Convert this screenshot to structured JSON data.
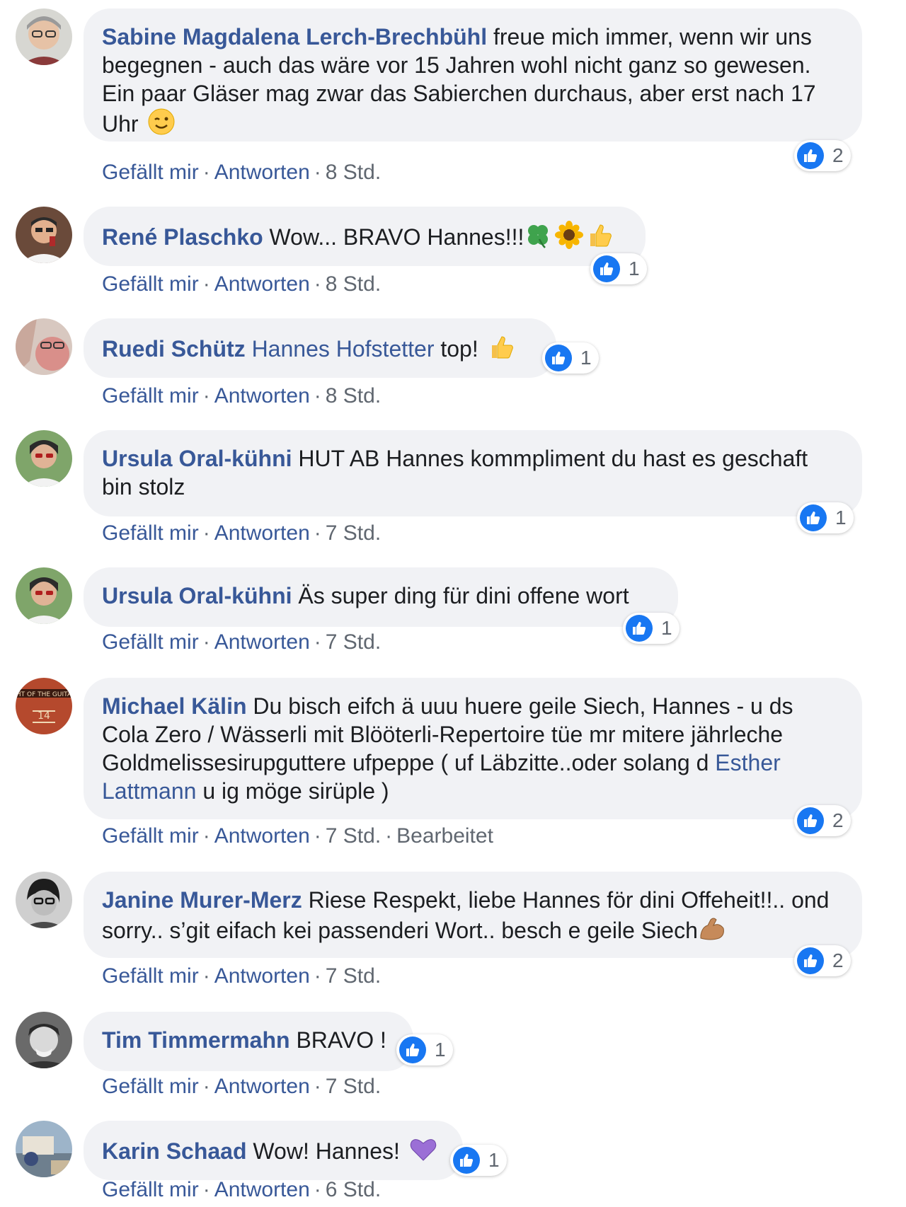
{
  "ui": {
    "like_label": "Gefällt mir",
    "reply_label": "Antworten",
    "dot": "·"
  },
  "colors": {
    "author": "#385898",
    "bubble_bg": "#f1f2f5",
    "like_blue": "#1877f2",
    "meta": "#606770"
  },
  "comments": [
    {
      "author": "Sabine Magdalena Lerch-Brechbühl",
      "text": "freue mich immer, wenn wir uns begegnen - auch das wäre vor 15 Jahren wohl nicht ganz so gewesen. Ein paar Gläser mag zwar das Sabierchen durchaus, aber erst nach 17 Uhr",
      "emoji": "winking-face-icon",
      "reactions": "2",
      "time": "8 Std.",
      "edited": ""
    },
    {
      "author": "René Plaschko",
      "text": "Wow... BRAVO Hannes!!!",
      "emoji": "clover-sunflower-thumbs-up-icons",
      "reactions": "1",
      "time": "8 Std.",
      "edited": ""
    },
    {
      "author": "Ruedi Schütz",
      "mention": "Hannes Hofstetter",
      "text": "top!",
      "emoji": "thumbs-up-icon",
      "reactions": "1",
      "time": "8 Std.",
      "edited": ""
    },
    {
      "author": "Ursula Oral-kühni",
      "text": "HUT AB Hannes kommpliment du hast es geschaft bin stolz",
      "reactions": "1",
      "time": "7 Std.",
      "edited": ""
    },
    {
      "author": "Ursula Oral-kühni",
      "text": "Äs super ding für dini offene wort",
      "reactions": "1",
      "time": "7 Std.",
      "edited": ""
    },
    {
      "author": "Michael Kälin",
      "text": "Du bisch eifch ä uuu huere geile Siech, Hannes - u ds Cola Zero / Wässerli mit Blööterli-Repertoire tüe mr mitere jährleche Goldmelissesirupguttere ufpeppe ( uf Läbzitte..oder solang d",
      "mention": "Esther Lattmann",
      "text_after": "u ig möge sirüple )",
      "reactions": "2",
      "time": "7 Std.",
      "edited": "Bearbeitet"
    },
    {
      "author": "Janine Murer-Merz",
      "text": "Riese Respekt, liebe Hannes för dini Offeheit!!.. ond sorry.. s’git eifach kei passenderi Wort.. besch e geile Siech",
      "emoji": "flexed-biceps-icon",
      "reactions": "2",
      "time": "7 Std.",
      "edited": ""
    },
    {
      "author": "Tim Timmermahn",
      "text": "BRAVO !",
      "reactions": "1",
      "time": "7 Std.",
      "edited": ""
    },
    {
      "author": "Karin Schaad",
      "text": "Wow! Hannes!",
      "emoji": "purple-heart-icon",
      "reactions": "1",
      "time": "6 Std.",
      "edited": ""
    }
  ]
}
